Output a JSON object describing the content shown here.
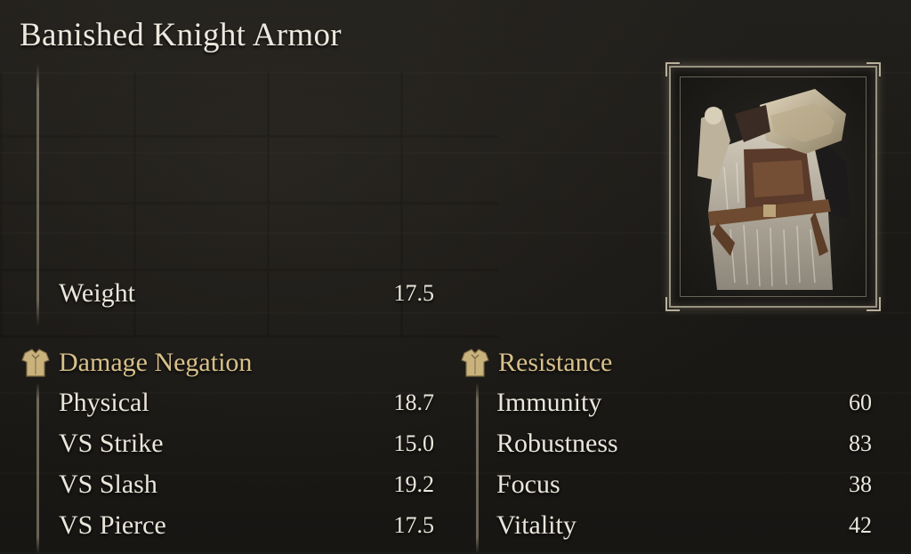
{
  "item": {
    "name": "Banished Knight Armor"
  },
  "weight": {
    "label": "Weight",
    "value": "17.5"
  },
  "damage_negation": {
    "header": "Damage Negation",
    "rows": [
      {
        "label": "Physical",
        "value": "18.7"
      },
      {
        "label": "VS Strike",
        "value": "15.0"
      },
      {
        "label": "VS Slash",
        "value": "19.2"
      },
      {
        "label": "VS Pierce",
        "value": "17.5"
      }
    ]
  },
  "resistance": {
    "header": "Resistance",
    "rows": [
      {
        "label": "Immunity",
        "value": "60"
      },
      {
        "label": "Robustness",
        "value": "83"
      },
      {
        "label": "Focus",
        "value": "38"
      },
      {
        "label": "Vitality",
        "value": "42"
      }
    ]
  },
  "icons": {
    "section_icon": "armor-chest-icon",
    "item_image": "banished-knight-armor-icon"
  },
  "colors": {
    "header_gold": "#d8c08a",
    "text": "#e9e5da",
    "background": "#1a1916"
  }
}
